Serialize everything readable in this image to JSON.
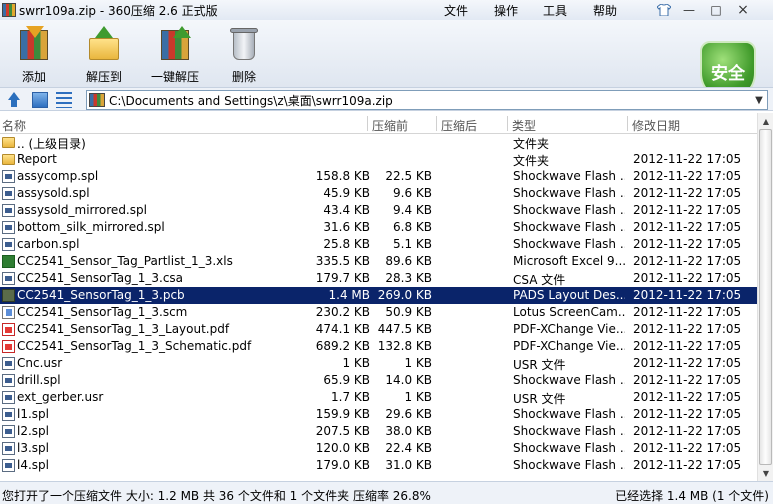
{
  "window": {
    "title": "swrr109a.zip - 360压缩 2.6 正式版",
    "menu": [
      "文件",
      "操作",
      "工具",
      "帮助"
    ],
    "controls": {
      "minimize": "—",
      "maximize": "□",
      "close": "×"
    }
  },
  "toolbar": {
    "add_label": "添加",
    "extract_label": "解压到",
    "oneclick_label": "一键解压",
    "delete_label": "删除",
    "safety_label": "安全"
  },
  "address": {
    "path": "C:\\Documents and Settings\\z\\桌面\\swrr109a.zip"
  },
  "columns": {
    "name": "名称",
    "packed": "压缩前",
    "size": "压缩后",
    "type": "类型",
    "date": "修改日期"
  },
  "files": [
    {
      "icon": "folder",
      "name": ".. (上级目录)",
      "packed": "",
      "size": "",
      "type": "文件夹",
      "date": ""
    },
    {
      "icon": "folder",
      "name": "Report",
      "packed": "",
      "size": "",
      "type": "文件夹",
      "date": "2012-11-22 17:05"
    },
    {
      "icon": "doc",
      "name": "assycomp.spl",
      "packed": "158.8 KB",
      "size": "22.5 KB",
      "type": "Shockwave Flash ...",
      "date": "2012-11-22 17:05"
    },
    {
      "icon": "doc",
      "name": "assysold.spl",
      "packed": "45.9 KB",
      "size": "9.6 KB",
      "type": "Shockwave Flash ...",
      "date": "2012-11-22 17:05"
    },
    {
      "icon": "doc",
      "name": "assysold_mirrored.spl",
      "packed": "43.4 KB",
      "size": "9.4 KB",
      "type": "Shockwave Flash ...",
      "date": "2012-11-22 17:05"
    },
    {
      "icon": "doc",
      "name": "bottom_silk_mirrored.spl",
      "packed": "31.6 KB",
      "size": "6.8 KB",
      "type": "Shockwave Flash ...",
      "date": "2012-11-22 17:05"
    },
    {
      "icon": "doc",
      "name": "carbon.spl",
      "packed": "25.8 KB",
      "size": "5.1 KB",
      "type": "Shockwave Flash ...",
      "date": "2012-11-22 17:05"
    },
    {
      "icon": "xls",
      "name": "CC2541_Sensor_Tag_Partlist_1_3.xls",
      "packed": "335.5 KB",
      "size": "89.6 KB",
      "type": "Microsoft Excel 9...",
      "date": "2012-11-22 17:05"
    },
    {
      "icon": "doc",
      "name": "CC2541_SensorTag_1_3.csa",
      "packed": "179.7 KB",
      "size": "28.3 KB",
      "type": "CSA 文件",
      "date": "2012-11-22 17:05"
    },
    {
      "icon": "pcb",
      "name": "CC2541_SensorTag_1_3.pcb",
      "packed": "1.4 MB",
      "size": "269.0 KB",
      "type": "PADS Layout Des...",
      "date": "2012-11-22 17:05",
      "selected": true
    },
    {
      "icon": "scm",
      "name": "CC2541_SensorTag_1_3.scm",
      "packed": "230.2 KB",
      "size": "50.9 KB",
      "type": "Lotus ScreenCam...",
      "date": "2012-11-22 17:05"
    },
    {
      "icon": "pdf",
      "name": "CC2541_SensorTag_1_3_Layout.pdf",
      "packed": "474.1 KB",
      "size": "447.5 KB",
      "type": "PDF-XChange Vie...",
      "date": "2012-11-22 17:05"
    },
    {
      "icon": "pdf",
      "name": "CC2541_SensorTag_1_3_Schematic.pdf",
      "packed": "689.2 KB",
      "size": "132.8 KB",
      "type": "PDF-XChange Vie...",
      "date": "2012-11-22 17:05"
    },
    {
      "icon": "doc",
      "name": "Cnc.usr",
      "packed": "1 KB",
      "size": "1 KB",
      "type": "USR 文件",
      "date": "2012-11-22 17:05"
    },
    {
      "icon": "doc",
      "name": "drill.spl",
      "packed": "65.9 KB",
      "size": "14.0 KB",
      "type": "Shockwave Flash ...",
      "date": "2012-11-22 17:05"
    },
    {
      "icon": "doc",
      "name": "ext_gerber.usr",
      "packed": "1.7 KB",
      "size": "1 KB",
      "type": "USR 文件",
      "date": "2012-11-22 17:05"
    },
    {
      "icon": "doc",
      "name": "l1.spl",
      "packed": "159.9 KB",
      "size": "29.6 KB",
      "type": "Shockwave Flash ...",
      "date": "2012-11-22 17:05"
    },
    {
      "icon": "doc",
      "name": "l2.spl",
      "packed": "207.5 KB",
      "size": "38.0 KB",
      "type": "Shockwave Flash ...",
      "date": "2012-11-22 17:05"
    },
    {
      "icon": "doc",
      "name": "l3.spl",
      "packed": "120.0 KB",
      "size": "22.4 KB",
      "type": "Shockwave Flash ...",
      "date": "2012-11-22 17:05"
    },
    {
      "icon": "doc",
      "name": "l4.spl",
      "packed": "179.0 KB",
      "size": "31.0 KB",
      "type": "Shockwave Flash ...",
      "date": "2012-11-22 17:05"
    }
  ],
  "status": {
    "left": "您打开了一个压缩文件 大小: 1.2 MB 共 36 个文件和 1 个文件夹 压缩率 26.8%",
    "right": "已经选择 1.4 MB (1 个文件)"
  },
  "icons": {
    "folder": "folder-icon",
    "doc": "spl-file-icon",
    "xls": "excel-file-icon",
    "pcb": "pcb-file-icon",
    "scm": "screencam-file-icon",
    "pdf": "pdf-file-icon"
  }
}
